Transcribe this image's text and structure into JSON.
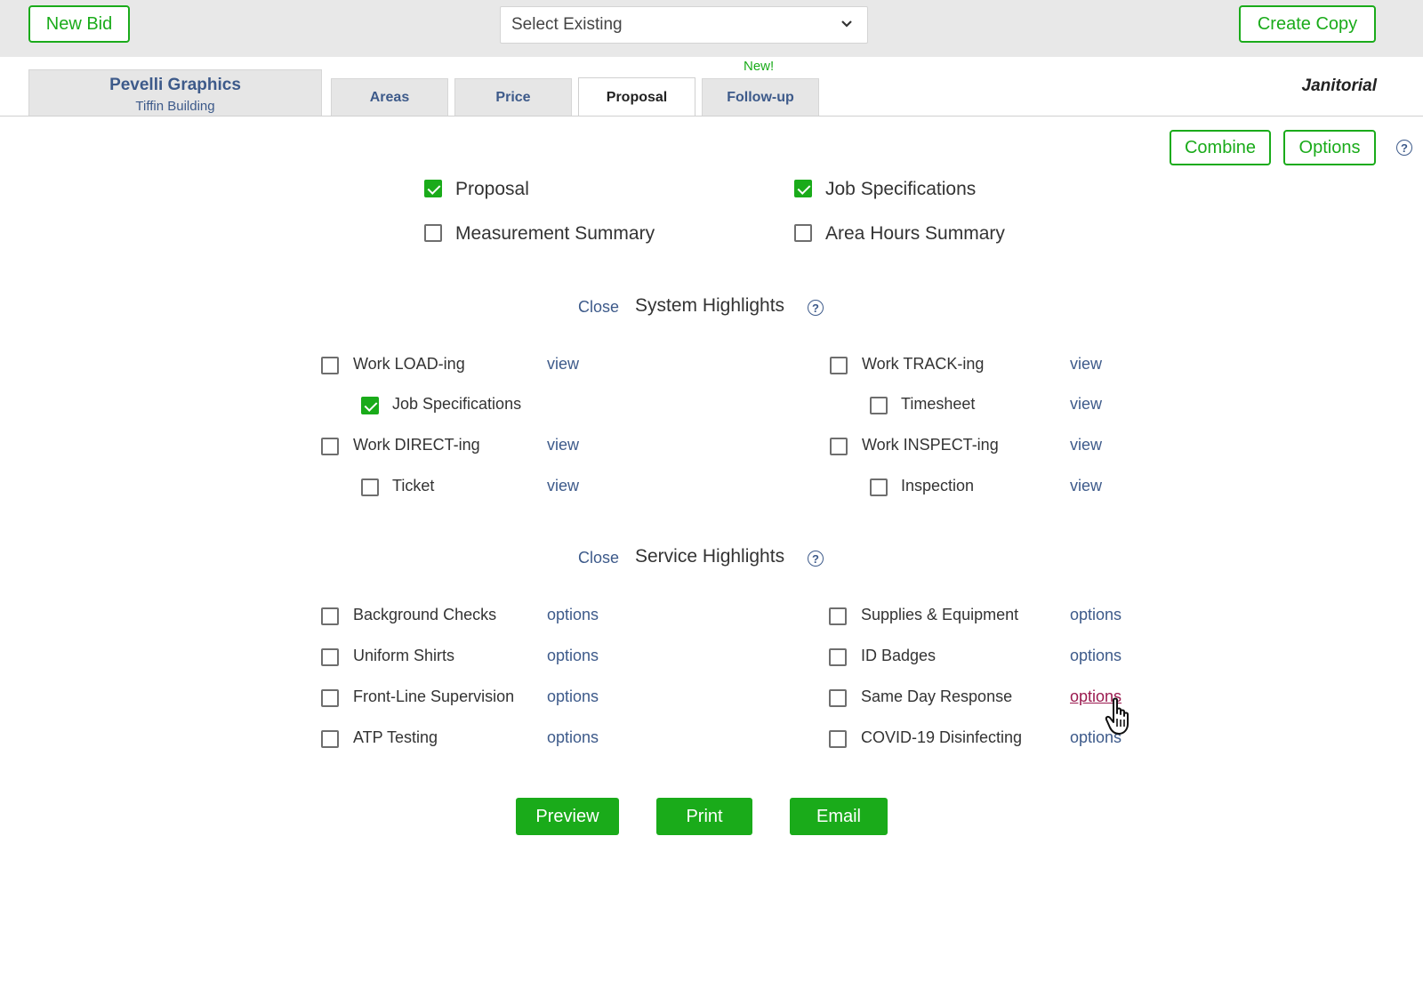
{
  "toolbar": {
    "new_bid_label": "New Bid",
    "select_value": "Select Existing",
    "create_copy_label": "Create Copy"
  },
  "header": {
    "company_name": "Pevelli Graphics",
    "building_name": "Tiffin Building",
    "tabs": [
      {
        "label": "Areas",
        "active": false
      },
      {
        "label": "Price",
        "active": false
      },
      {
        "label": "Proposal",
        "active": true
      },
      {
        "label": "Follow-up",
        "active": false
      }
    ],
    "new_badge": "New!",
    "division": "Janitorial"
  },
  "actions": {
    "combine_label": "Combine",
    "options_label": "Options",
    "help_symbol": "?"
  },
  "documents": [
    {
      "label": "Proposal",
      "checked": true
    },
    {
      "label": "Job Specifications",
      "checked": true
    },
    {
      "label": "Measurement Summary",
      "checked": false
    },
    {
      "label": "Area Hours Summary",
      "checked": false
    }
  ],
  "system_highlights": {
    "close_label": "Close",
    "title": "System Highlights",
    "items": [
      {
        "label": "Work LOAD-ing",
        "link": "view",
        "checked": false
      },
      {
        "label": "Job Specifications",
        "link": "",
        "checked": true
      },
      {
        "label": "Work DIRECT-ing",
        "link": "view",
        "checked": false
      },
      {
        "label": "Ticket",
        "link": "view",
        "checked": false
      },
      {
        "label": "Work TRACK-ing",
        "link": "view",
        "checked": false
      },
      {
        "label": "Timesheet",
        "link": "view",
        "checked": false
      },
      {
        "label": "Work INSPECT-ing",
        "link": "view",
        "checked": false
      },
      {
        "label": "Inspection",
        "link": "view",
        "checked": false
      }
    ]
  },
  "service_highlights": {
    "close_label": "Close",
    "title": "Service Highlights",
    "items": [
      {
        "label": "Background Checks",
        "link": "options",
        "checked": false
      },
      {
        "label": "Uniform Shirts",
        "link": "options",
        "checked": false
      },
      {
        "label": "Front-Line Supervision",
        "link": "options",
        "checked": false
      },
      {
        "label": "ATP Testing",
        "link": "options",
        "checked": false
      },
      {
        "label": "Supplies & Equipment",
        "link": "options",
        "checked": false
      },
      {
        "label": "ID Badges",
        "link": "options",
        "checked": false
      },
      {
        "label": "Same Day Response",
        "link": "options",
        "checked": false
      },
      {
        "label": "COVID-19 Disinfecting",
        "link": "options",
        "checked": false
      }
    ]
  },
  "footer": {
    "preview_label": "Preview",
    "print_label": "Print",
    "email_label": "Email"
  },
  "colors": {
    "accent_green": "#1aab1a",
    "link_blue": "#3d5a8a",
    "hover_link": "#9b1b50"
  }
}
